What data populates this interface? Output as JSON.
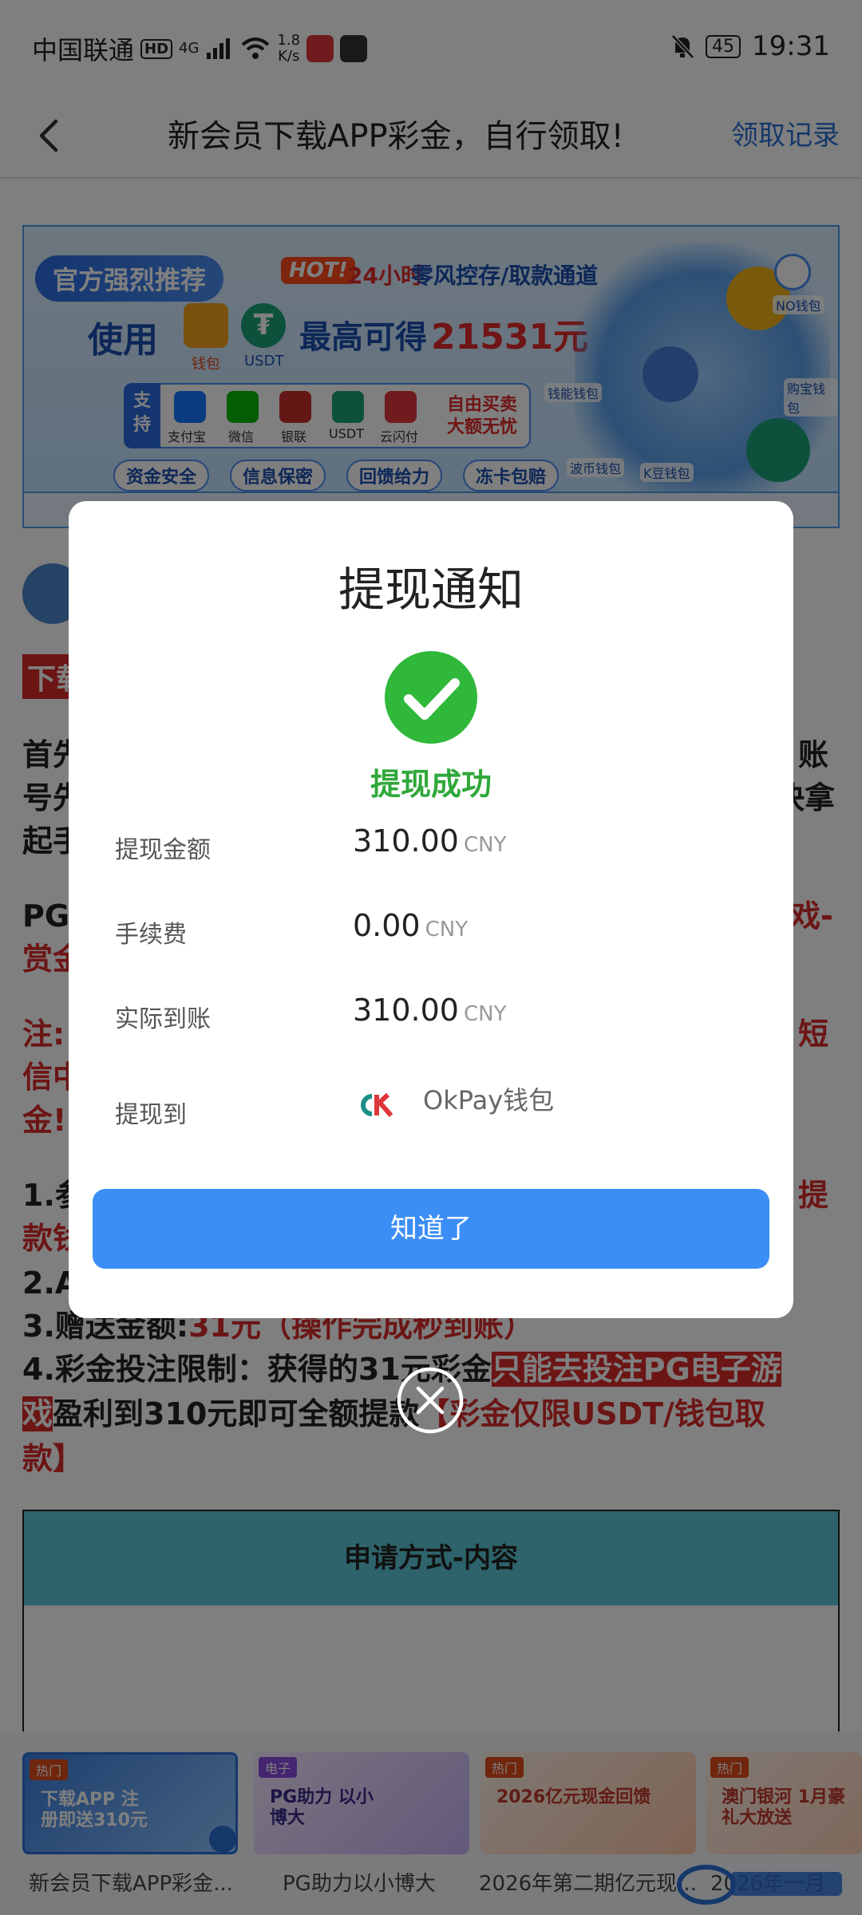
{
  "status_bar": {
    "carrier": "中国联通",
    "hd": "HD",
    "net": "4G",
    "speed_value": "1.8",
    "speed_unit": "K/s",
    "battery": "45",
    "time": "19:31"
  },
  "nav": {
    "title": "新会员下载APP彩金，自行领取!",
    "right_link": "领取记录"
  },
  "banner": {
    "recommend": "官方强烈推荐",
    "hot": "HOT!",
    "hours": "24小时",
    "tagline": "零风控存/取款通道",
    "use": "使用",
    "wallet_label": "钱包",
    "usdt_label": "USDT",
    "max_text": "最高可得",
    "amount": "21531元",
    "support": "支持",
    "pay_methods": [
      "支付宝",
      "微信",
      "银联",
      "USDT",
      "云闪付"
    ],
    "free_line1": "自由买卖",
    "free_line2": "大额无忧",
    "pills": [
      "资金安全",
      "信息保密",
      "回馈给力",
      "冻卡包赔"
    ],
    "wallets": [
      "NO钱包",
      "钱能钱包",
      "购宝钱包",
      "波币钱包",
      "K豆钱包"
    ]
  },
  "content": {
    "tag": "下载",
    "line1_left": "首先",
    "line1_right": "账",
    "line2_left": "号先",
    "line2_right": "快拿",
    "line3_left": "起手",
    "line4_left": "PG",
    "line4_right": "戏-",
    "line5_left": "赏金",
    "line6_left": "注:",
    "line6_right": "短",
    "line7_left": "信中",
    "line8_left": "金!",
    "line9_left": "1.参",
    "line9_right": "提",
    "line10_left": "款钱",
    "line11_left": "2.A",
    "item3_label": "3.赠送金额:",
    "item3_value": "31元（操作完成秒到账）",
    "item4_label": "4.彩金投注限制：获得的31元彩金",
    "item4_highlight": "只能去投注PG电子游",
    "item4_hl2": "戏",
    "item4_text": "盈利到310元即可全额提款",
    "item4_red": "【彩金仅限USDT/钱包取",
    "item4_red2": "款】",
    "table_header": "申请方式-内容"
  },
  "bottom_cards": [
    {
      "badge": "热门",
      "text": "下载APP 注册即送310元",
      "caption": "新会员下载APP彩金..."
    },
    {
      "badge": "电子",
      "text": "PG助力 以小博大",
      "caption": "PG助力以小博大"
    },
    {
      "badge": "热门",
      "text": "2026亿元现金回馈",
      "caption": "2026年第二期亿元现..."
    },
    {
      "badge": "热门",
      "text": "澳门银河 1月豪礼大放送",
      "caption": "2026年一月"
    }
  ],
  "modal": {
    "title": "提现通知",
    "status": "提现成功",
    "rows": [
      {
        "label": "提现金额",
        "value": "310.00",
        "unit": "CNY"
      },
      {
        "label": "手续费",
        "value": "0.00",
        "unit": "CNY"
      },
      {
        "label": "实际到账",
        "value": "310.00",
        "unit": "CNY"
      }
    ],
    "dest_label": "提现到",
    "dest_logo": "OK",
    "dest_name": "OkPay钱包",
    "button": "知道了"
  },
  "colors": {
    "primary_button": "#3b8ef5",
    "success_green": "#2fa83a",
    "accent_red": "#d92a2a",
    "link_blue": "#2a70d6"
  }
}
